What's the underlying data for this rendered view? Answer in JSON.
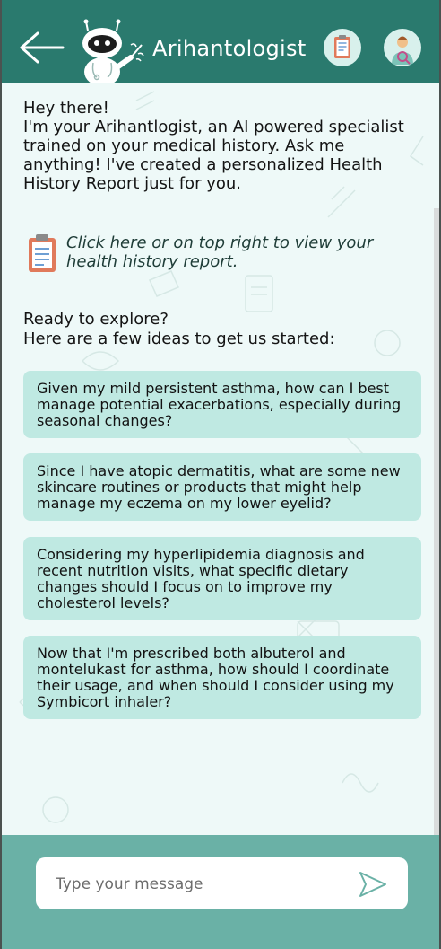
{
  "header": {
    "title": "Arihantologist",
    "back_icon": "arrow-left-icon",
    "report_icon": "clipboard-icon",
    "profile_icon": "doctor-avatar-icon",
    "background_color": "#2a7a6e"
  },
  "chat": {
    "greeting_lines": [
      "Hey there!",
      "I'm your Arihantlogist, an AI powered specialist trained on your medical history. Ask me anything! I've created a personalized Health History Report just for you."
    ],
    "report_link_text": "Click here or on top right to view your health history report.",
    "explore_title": "Ready to explore?",
    "explore_subtitle": "Here are a few ideas to get us started:",
    "suggestions": [
      "Given my mild persistent asthma, how can I best manage potential exacerbations, especially during seasonal changes?",
      "Since I have atopic dermatitis, what are some new skincare routines or products that might help manage my eczema on my lower eyelid?",
      "Considering my hyperlipidemia diagnosis and recent nutrition visits, what specific dietary changes should I focus on to improve my cholesterol levels?",
      "Now that I'm prescribed both albuterol and montelukast for asthma, how should I coordinate their usage, and when should I consider using my Symbicort inhaler?"
    ],
    "suggestion_color": "#bfe9e2"
  },
  "composer": {
    "placeholder": "Type your message",
    "send_icon": "send-icon",
    "background_color": "#6ab1a6"
  }
}
